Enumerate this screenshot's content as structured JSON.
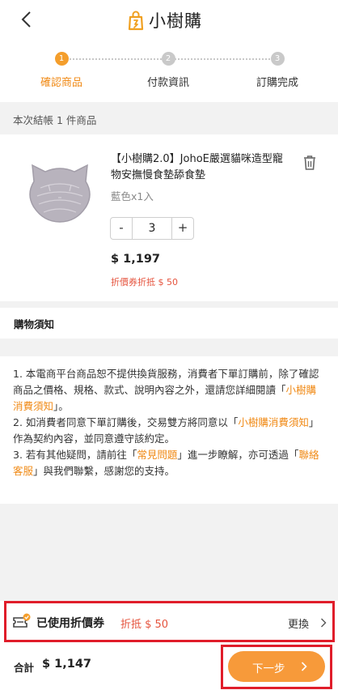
{
  "header": {
    "back_icon": "chevron-left-icon",
    "logo_icon": "shopping-bag-logo-icon",
    "brand_name": "小樹購"
  },
  "steps": [
    {
      "number": "1",
      "label": "確認商品",
      "state": "active"
    },
    {
      "number": "2",
      "label": "付款資訊",
      "state": "inactive"
    },
    {
      "number": "3",
      "label": "訂購完成",
      "state": "inactive"
    }
  ],
  "checkout_summary": "本次結帳 1 件商品",
  "product": {
    "title": "【小樹購2.0】JohoE嚴選貓咪造型寵物安撫慢食墊舔食墊",
    "variant": "藍色x1入",
    "quantity": "3",
    "minus_label": "-",
    "plus_label": "+",
    "price": "$ 1,197",
    "coupon_note": "折價券折抵 $ 50",
    "delete_icon": "trash-icon"
  },
  "notice": {
    "heading": "購物須知",
    "p1_before": "1. 本電商平台商品恕不提供換貨服務，消費者下單訂購前，除了確認商品之價格、規格、款式、說明內容之外，還請您詳細閱讀「",
    "p1_link": "小樹購消費須知",
    "p1_after": "」。",
    "p2_before": "2. 如消費者同意下單訂購後，交易雙方將同意以「",
    "p2_link": "小樹購消費須知",
    "p2_after": "」 作為契約內容，並同意遵守該約定。",
    "p3_before": "3. 若有其他疑問，請前往「",
    "p3_link1": "常見問題",
    "p3_middle": "」進一步瞭解，亦可透過「",
    "p3_link2": "聯絡客服",
    "p3_after": "」與我們聯繫，感謝您的支持。"
  },
  "coupon": {
    "icon": "coupon-ticket-icon",
    "used_label": "已使用折價券",
    "discount": "折抵 $ 50",
    "change_label": "更換"
  },
  "footer": {
    "total_label": "合計",
    "total_value": "$ 1,147",
    "next_label": "下一步"
  },
  "colors": {
    "accent": "#f49e2c",
    "discount_red": "#e5533d",
    "highlight_box": "#e01d2a"
  }
}
